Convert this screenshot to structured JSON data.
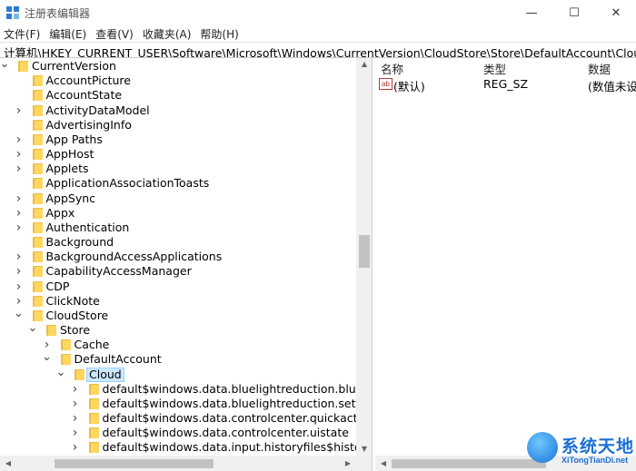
{
  "window": {
    "title": "注册表编辑器",
    "minimize_glyph": "—",
    "maximize_glyph": "☐",
    "close_glyph": "✕"
  },
  "menu": [
    "文件(F)",
    "编辑(E)",
    "查看(V)",
    "收藏夹(A)",
    "帮助(H)"
  ],
  "address": "计算机\\HKEY_CURRENT_USER\\Software\\Microsoft\\Windows\\CurrentVersion\\CloudStore\\Store\\DefaultAccount\\Cloud",
  "tree": [
    {
      "label": "CurrentVersion",
      "depth": 1,
      "expander": "expanded",
      "selected": false
    },
    {
      "label": "AccountPicture",
      "depth": 2,
      "expander": "none",
      "selected": false
    },
    {
      "label": "AccountState",
      "depth": 2,
      "expander": "none",
      "selected": false
    },
    {
      "label": "ActivityDataModel",
      "depth": 2,
      "expander": "collapsed",
      "selected": false
    },
    {
      "label": "AdvertisingInfo",
      "depth": 2,
      "expander": "none",
      "selected": false
    },
    {
      "label": "App Paths",
      "depth": 2,
      "expander": "collapsed",
      "selected": false
    },
    {
      "label": "AppHost",
      "depth": 2,
      "expander": "collapsed",
      "selected": false
    },
    {
      "label": "Applets",
      "depth": 2,
      "expander": "collapsed",
      "selected": false
    },
    {
      "label": "ApplicationAssociationToasts",
      "depth": 2,
      "expander": "none",
      "selected": false
    },
    {
      "label": "AppSync",
      "depth": 2,
      "expander": "collapsed",
      "selected": false
    },
    {
      "label": "Appx",
      "depth": 2,
      "expander": "collapsed",
      "selected": false
    },
    {
      "label": "Authentication",
      "depth": 2,
      "expander": "collapsed",
      "selected": false
    },
    {
      "label": "Background",
      "depth": 2,
      "expander": "none",
      "selected": false
    },
    {
      "label": "BackgroundAccessApplications",
      "depth": 2,
      "expander": "collapsed",
      "selected": false
    },
    {
      "label": "CapabilityAccessManager",
      "depth": 2,
      "expander": "collapsed",
      "selected": false
    },
    {
      "label": "CDP",
      "depth": 2,
      "expander": "collapsed",
      "selected": false
    },
    {
      "label": "ClickNote",
      "depth": 2,
      "expander": "collapsed",
      "selected": false
    },
    {
      "label": "CloudStore",
      "depth": 2,
      "expander": "expanded",
      "selected": false
    },
    {
      "label": "Store",
      "depth": 3,
      "expander": "expanded",
      "selected": false
    },
    {
      "label": "Cache",
      "depth": 4,
      "expander": "collapsed",
      "selected": false
    },
    {
      "label": "DefaultAccount",
      "depth": 4,
      "expander": "expanded",
      "selected": false
    },
    {
      "label": "Cloud",
      "depth": 5,
      "expander": "expanded",
      "selected": true
    },
    {
      "label": "default$windows.data.bluelightreduction.bluelig",
      "depth": 6,
      "expander": "collapsed",
      "selected": false
    },
    {
      "label": "default$windows.data.bluelightreduction.settings",
      "depth": 6,
      "expander": "collapsed",
      "selected": false
    },
    {
      "label": "default$windows.data.controlcenter.quickactionu",
      "depth": 6,
      "expander": "collapsed",
      "selected": false
    },
    {
      "label": "default$windows.data.controlcenter.uistate",
      "depth": 6,
      "expander": "collapsed",
      "selected": false
    },
    {
      "label": "default$windows.data.input.historyfiles$historyfil",
      "depth": 6,
      "expander": "collapsed",
      "selected": false
    }
  ],
  "list": {
    "columns": [
      "名称",
      "类型",
      "数据"
    ],
    "rows": [
      {
        "icon": "ab",
        "name": "(默认)",
        "type": "REG_SZ",
        "data": "(数值未设"
      }
    ]
  },
  "watermark": {
    "cn": "系统天地",
    "en": "XiTongTianDi.net"
  },
  "icons": {
    "app": "registry-editor-icon",
    "folder": "folder-icon",
    "string_value": "string-value-icon"
  },
  "colors": {
    "selection_bg": "#cce8ff",
    "folder": "#ffd660",
    "accent": "#1a6fd6"
  }
}
